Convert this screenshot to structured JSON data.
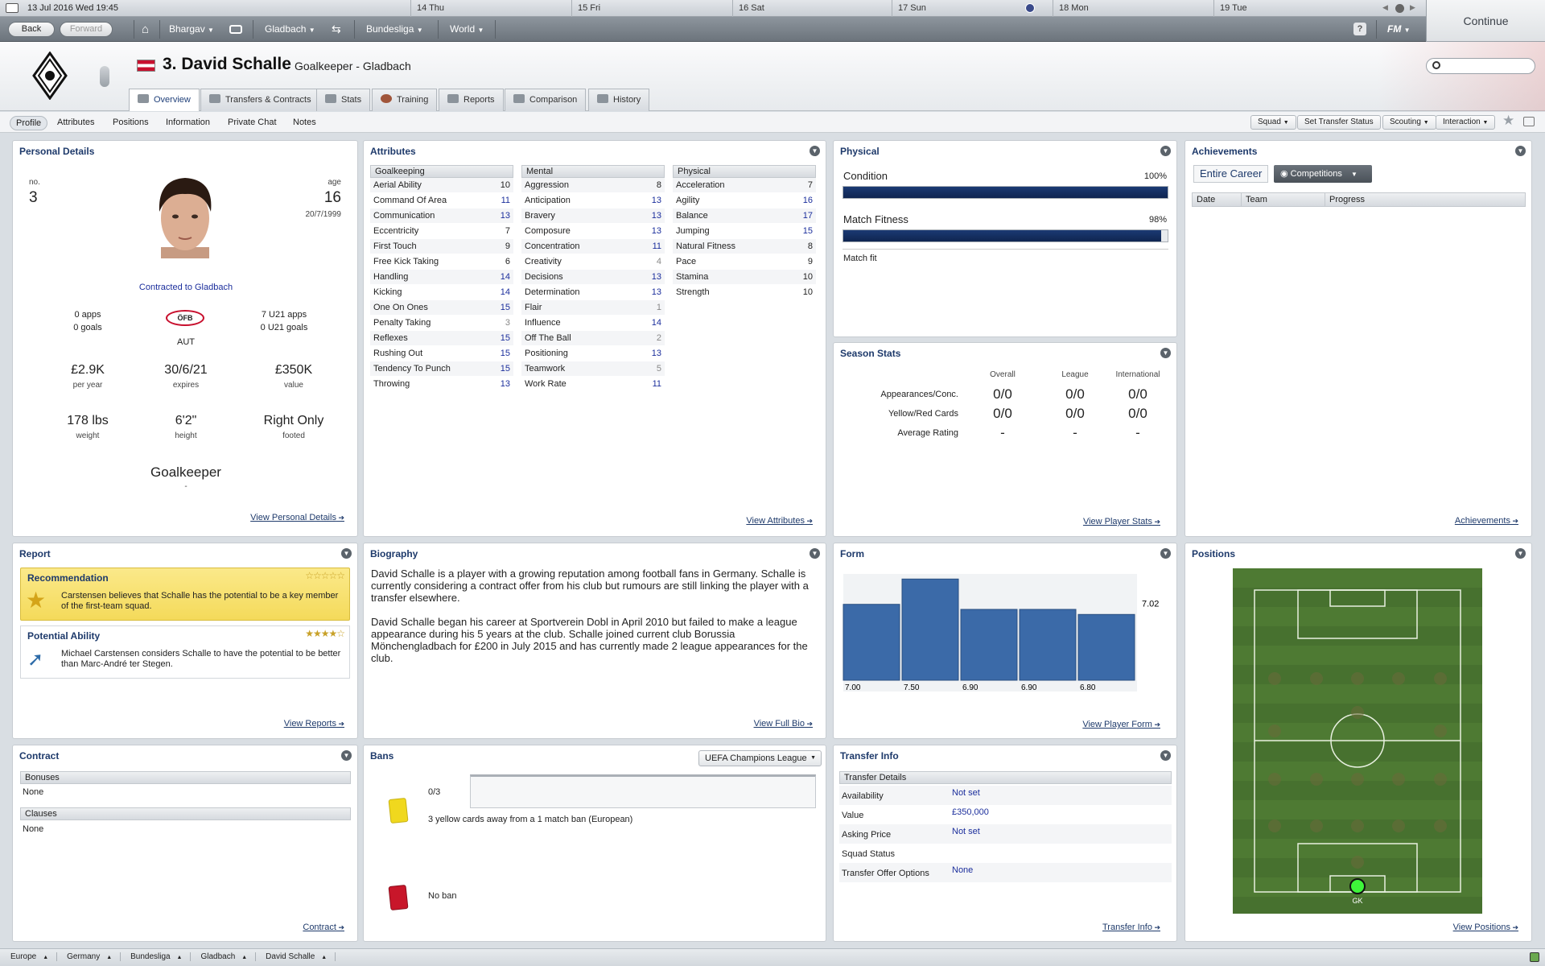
{
  "topbar": {
    "date": "13 Jul 2016  Wed 19:45",
    "days": [
      "14 Thu",
      "15 Fri",
      "16 Sat",
      "17 Sun",
      "18 Mon",
      "19 Tue"
    ]
  },
  "nav": {
    "back": "Back",
    "forward": "Forward",
    "manager": "Bhargav",
    "club": "Gladbach",
    "league": "Bundesliga",
    "world": "World",
    "fm": "FM",
    "continue": "Continue"
  },
  "player": {
    "name": "3. David Schalle",
    "role": "Goalkeeper - Gladbach"
  },
  "tabs": [
    "Overview",
    "Transfers & Contracts",
    "Stats",
    "Training",
    "Reports",
    "Comparison",
    "History"
  ],
  "subnav": {
    "items": [
      "Profile",
      "Attributes",
      "Positions",
      "Information",
      "Private Chat",
      "Notes"
    ],
    "buttons": [
      "Squad",
      "Set Transfer Status",
      "Scouting",
      "Interaction"
    ]
  },
  "personal": {
    "title": "Personal Details",
    "no_label": "no.",
    "no": "3",
    "age_label": "age",
    "age": "16",
    "dob": "20/7/1999",
    "contract": "Contracted to Gladbach",
    "apps": "0 apps",
    "goals": "0 goals",
    "u21apps": "7 U21 apps",
    "u21goals": "0 U21 goals",
    "nation": "AUT",
    "fed": "ÖFB",
    "wage": "£2.9K",
    "wage_l": "per year",
    "expires": "30/6/21",
    "expires_l": "expires",
    "value": "£350K",
    "value_l": "value",
    "weight": "178 lbs",
    "weight_l": "weight",
    "height": "6'2\"",
    "height_l": "height",
    "foot": "Right Only",
    "foot_l": "footed",
    "position": "Goalkeeper",
    "position_sub": "-",
    "link": "View Personal Details"
  },
  "attributes": {
    "title": "Attributes",
    "link": "View Attributes",
    "goalkeeping": {
      "head": "Goalkeeping",
      "rows": [
        [
          "Aerial Ability",
          "10"
        ],
        [
          "Command Of Area",
          "11"
        ],
        [
          "Communication",
          "13"
        ],
        [
          "Eccentricity",
          "7"
        ],
        [
          "First Touch",
          "9"
        ],
        [
          "Free Kick Taking",
          "6"
        ],
        [
          "Handling",
          "14"
        ],
        [
          "Kicking",
          "14"
        ],
        [
          "One On Ones",
          "15"
        ],
        [
          "Penalty Taking",
          "3"
        ],
        [
          "Reflexes",
          "15"
        ],
        [
          "Rushing Out",
          "15"
        ],
        [
          "Tendency To Punch",
          "15"
        ],
        [
          "Throwing",
          "13"
        ]
      ]
    },
    "mental": {
      "head": "Mental",
      "rows": [
        [
          "Aggression",
          "8"
        ],
        [
          "Anticipation",
          "13"
        ],
        [
          "Bravery",
          "13"
        ],
        [
          "Composure",
          "13"
        ],
        [
          "Concentration",
          "11"
        ],
        [
          "Creativity",
          "4"
        ],
        [
          "Decisions",
          "13"
        ],
        [
          "Determination",
          "13"
        ],
        [
          "Flair",
          "1"
        ],
        [
          "Influence",
          "14"
        ],
        [
          "Off The Ball",
          "2"
        ],
        [
          "Positioning",
          "13"
        ],
        [
          "Teamwork",
          "5"
        ],
        [
          "Work Rate",
          "11"
        ]
      ]
    },
    "physical": {
      "head": "Physical",
      "rows": [
        [
          "Acceleration",
          "7"
        ],
        [
          "Agility",
          "16"
        ],
        [
          "Balance",
          "17"
        ],
        [
          "Jumping",
          "15"
        ],
        [
          "Natural Fitness",
          "8"
        ],
        [
          "Pace",
          "9"
        ],
        [
          "Stamina",
          "10"
        ],
        [
          "Strength",
          "10"
        ]
      ]
    }
  },
  "physical": {
    "title": "Physical",
    "condition": "Condition",
    "condition_val": "100%",
    "condition_frac": 1.0,
    "fitness": "Match Fitness",
    "fitness_val": "98%",
    "fitness_frac": 0.98,
    "status": "Match fit"
  },
  "season": {
    "title": "Season Stats",
    "cols": [
      "Overall",
      "League",
      "International"
    ],
    "rows": [
      [
        "Appearances/Conc.",
        "0/0",
        "0/0",
        "0/0"
      ],
      [
        "Yellow/Red Cards",
        "0/0",
        "0/0",
        "0/0"
      ],
      [
        "Average Rating",
        "-",
        "-",
        "-"
      ]
    ],
    "link": "View Player Stats"
  },
  "achievements": {
    "title": "Achievements",
    "career": "Entire Career",
    "competitions": "Competitions",
    "cols": [
      "Date",
      "Team",
      "Progress"
    ],
    "link": "Achievements"
  },
  "report": {
    "title": "Report",
    "rec_title": "Recommendation",
    "rec_text": "Carstensen believes that Schalle has the potential to be a key member of the first-team squad.",
    "pa_title": "Potential Ability",
    "pa_text": "Michael Carstensen considers Schalle to have the potential to be better than Marc-André ter Stegen.",
    "link": "View Reports"
  },
  "bio": {
    "title": "Biography",
    "p1": "David Schalle is a player with a growing reputation among football fans in Germany. Schalle is currently considering a contract offer from his club but rumours are still linking the player with a transfer elsewhere.",
    "p2": "David Schalle began his career at Sportverein Dobl in April 2010 but failed to make a league appearance during his 5 years at the club. Schalle joined current club Borussia Mönchengladbach for £200 in July 2015 and has currently made 2 league appearances for the club.",
    "link": "View Full Bio"
  },
  "form": {
    "title": "Form",
    "avg": "7.02",
    "link": "View Player Form"
  },
  "chart_data": {
    "type": "bar",
    "values": [
      7.0,
      7.5,
      6.9,
      6.9,
      6.8
    ],
    "labels": [
      "7.00",
      "7.50",
      "6.90",
      "6.90",
      "6.80"
    ],
    "ylim": [
      5.5,
      7.6
    ],
    "reference": 7.02
  },
  "positions": {
    "title": "Positions",
    "gk": "GK",
    "link": "View Positions"
  },
  "contract": {
    "title": "Contract",
    "bonuses": "Bonuses",
    "bonuses_val": "None",
    "clauses": "Clauses",
    "clauses_val": "None",
    "link": "Contract"
  },
  "bans": {
    "title": "Bans",
    "competition": "UEFA Champions League",
    "yc": "0/3",
    "yc_text": "3 yellow cards away from a 1 match ban (European)",
    "red_text": "No ban"
  },
  "transfer": {
    "title": "Transfer Info",
    "head": "Transfer Details",
    "rows": [
      [
        "Availability",
        "Not set"
      ],
      [
        "Value",
        "£350,000"
      ],
      [
        "Asking Price",
        "Not set"
      ],
      [
        "Squad Status",
        ""
      ],
      [
        "Transfer Offer Options",
        "None"
      ]
    ],
    "link": "Transfer Info"
  },
  "breadcrumbs": [
    "Europe",
    "Germany",
    "Bundesliga",
    "Gladbach",
    "David Schalle"
  ],
  "colors": {
    "accent": "#1e3a6b",
    "bar": "#3b6aa8",
    "pitch": "#4e7a33"
  }
}
